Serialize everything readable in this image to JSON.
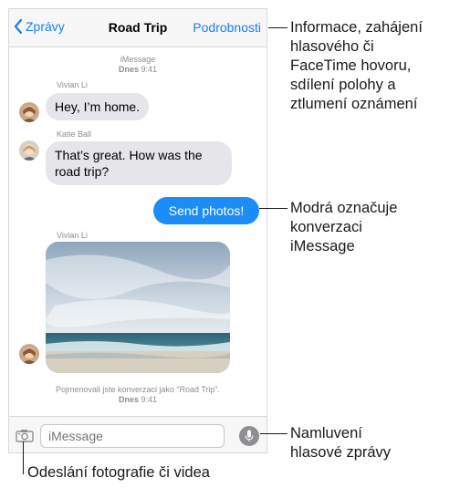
{
  "navbar": {
    "back_label": "Zprávy",
    "title": "Road Trip",
    "details_label": "Podrobnosti"
  },
  "conversation": {
    "header_service": "iMessage",
    "header_day": "Dnes",
    "header_time": "9:41",
    "messages": [
      {
        "sender": "Vivian Li",
        "text": "Hey, I’m home."
      },
      {
        "sender": "Katie Ball",
        "text_line1": "That’s great. How was the",
        "text_line2": "road trip?"
      },
      {
        "text": "Send photos!"
      },
      {
        "sender": "Vivian Li"
      }
    ],
    "footer_note": "Pojmenovali jste konverzaci jako “Road Trip”.",
    "footer_day": "Dnes",
    "footer_time": "9:41"
  },
  "input_bar": {
    "placeholder": "iMessage"
  },
  "callouts": {
    "details_line1": "Informace, zahájení",
    "details_line2": "hlasového či",
    "details_line3": "FaceTime hovoru,",
    "details_line4": "sdílení polohy a",
    "details_line5": "ztlumení oznámení",
    "blue_line1": "Modrá označuje",
    "blue_line2": "konverzaci",
    "blue_line3": "iMessage",
    "voice_line1": "Namluvení",
    "voice_line2": "hlasové zprávy",
    "camera": "Odeslání fotografie či videa"
  },
  "colors": {
    "accent": "#147efb",
    "outgoing_bubble": "#1b8cf8",
    "incoming_bubble": "#e5e5ea"
  }
}
